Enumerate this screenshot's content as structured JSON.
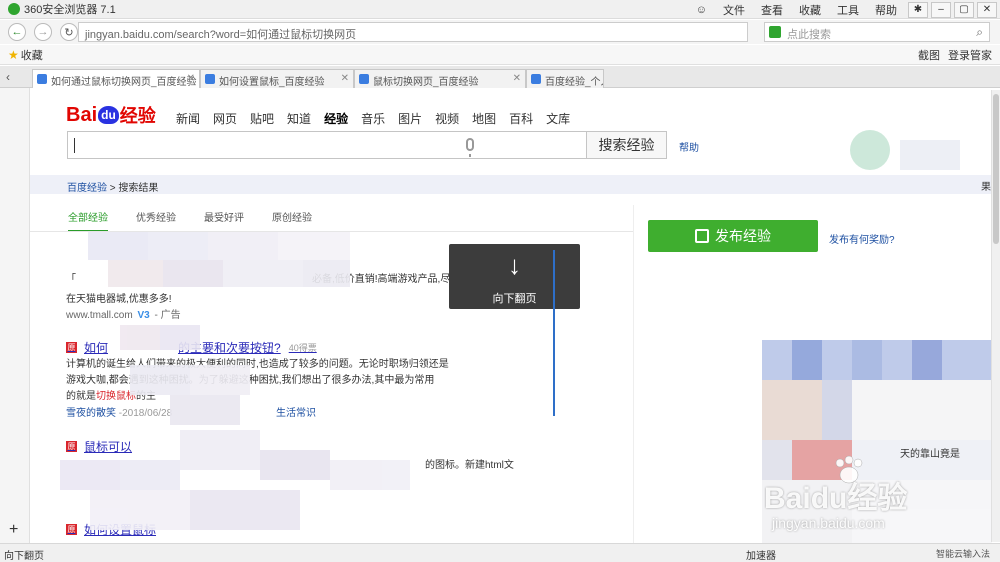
{
  "browser": {
    "title": "360安全浏览器 7.1",
    "menu": [
      "文件",
      "查看",
      "收藏",
      "工具",
      "帮助"
    ],
    "address_url": "jingyan.baidu.com/search?word=如何通过鼠标切换网页",
    "search_placeholder": "点此搜索",
    "favorites_label": "收藏",
    "fav_right": [
      "截图",
      "登录管家"
    ],
    "tabs": [
      {
        "label": "如何通过鼠标切换网页_百度经验",
        "active": true
      },
      {
        "label": "如何设置鼠标_百度经验",
        "active": false
      },
      {
        "label": "鼠标切换网页_百度经验",
        "active": false
      },
      {
        "label": "百度经验_个人",
        "active": false
      }
    ]
  },
  "baidu": {
    "logo": {
      "bai": "Bai",
      "du": "du",
      "jy": "经验"
    },
    "nav": [
      "新闻",
      "网页",
      "贴吧",
      "知道",
      "经验",
      "音乐",
      "图片",
      "视频",
      "地图",
      "百科",
      "文库"
    ],
    "nav_active": "经验",
    "search_button": "搜索经验",
    "help": "帮助",
    "breadcrumb": {
      "home": "百度经验",
      "sep": ">",
      "current": "搜索结果"
    },
    "breadcrumb_right": "果",
    "result_tabs": [
      "全部经验",
      "优秀经验",
      "最受好评",
      "原创经验"
    ],
    "publish_button": "发布经验",
    "reward_link": "发布有何奖励?"
  },
  "results": {
    "ad_line1": "「",
    "ad_line1_tail": "必备,低价直销!高端游戏产品,尽",
    "ad_line2": "在天猫电器城,优惠多多!",
    "ad_url": "www.tmall.com",
    "ad_v": "V3",
    "ad_tag": "- 广告",
    "items": [
      {
        "title_prefix": "如何",
        "title_suffix": "的主要和次要按钮?",
        "votes": "40得票",
        "snippet1": "计算机的诞生给人们带来的极大便利的同时,也造成了较多的问题。无论时职场归领还是",
        "snippet2": "游戏大咖,都会遇到这种困扰。为了躲避这种困扰,我们想出了很多办法,其中最为常用",
        "snippet3_pre": "的就是",
        "snippet3_hl": "切换鼠标",
        "snippet3_post": "的主",
        "author": "雪夜的散笑",
        "date": "-2018/06/28",
        "category": "生活常识"
      },
      {
        "title_prefix": "鼠标可以",
        "snippet1_tail": "的图标。新建html文"
      },
      {
        "title_prefix": "如何设置鼠标"
      }
    ]
  },
  "overlay": {
    "arrow": "↓",
    "label": "向下翻页"
  },
  "watermark": {
    "big": "Bai",
    "du": "du",
    "jy": "经验",
    "small": "jingyan.baidu.com"
  },
  "side_snippets": [
    "天的靠山竟是"
  ],
  "status": {
    "left": "向下翻页",
    "right": "加速器",
    "right2": "智能云输入法"
  }
}
